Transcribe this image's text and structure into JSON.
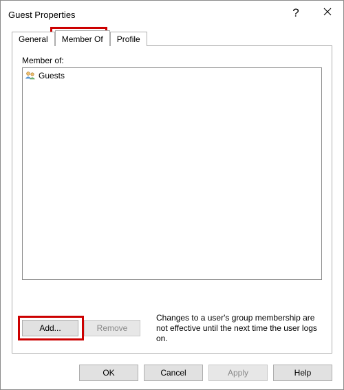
{
  "window": {
    "title": "Guest Properties"
  },
  "tabs": {
    "general": "General",
    "member_of": "Member Of",
    "profile": "Profile",
    "active": "member_of"
  },
  "body": {
    "member_of_label": "Member of:",
    "groups": [
      {
        "name": "Guests"
      }
    ],
    "add_label": "Add...",
    "remove_label": "Remove",
    "note": "Changes to a user's group membership are not effective until the next time the user logs on."
  },
  "footer": {
    "ok": "OK",
    "cancel": "Cancel",
    "apply": "Apply",
    "help": "Help"
  }
}
